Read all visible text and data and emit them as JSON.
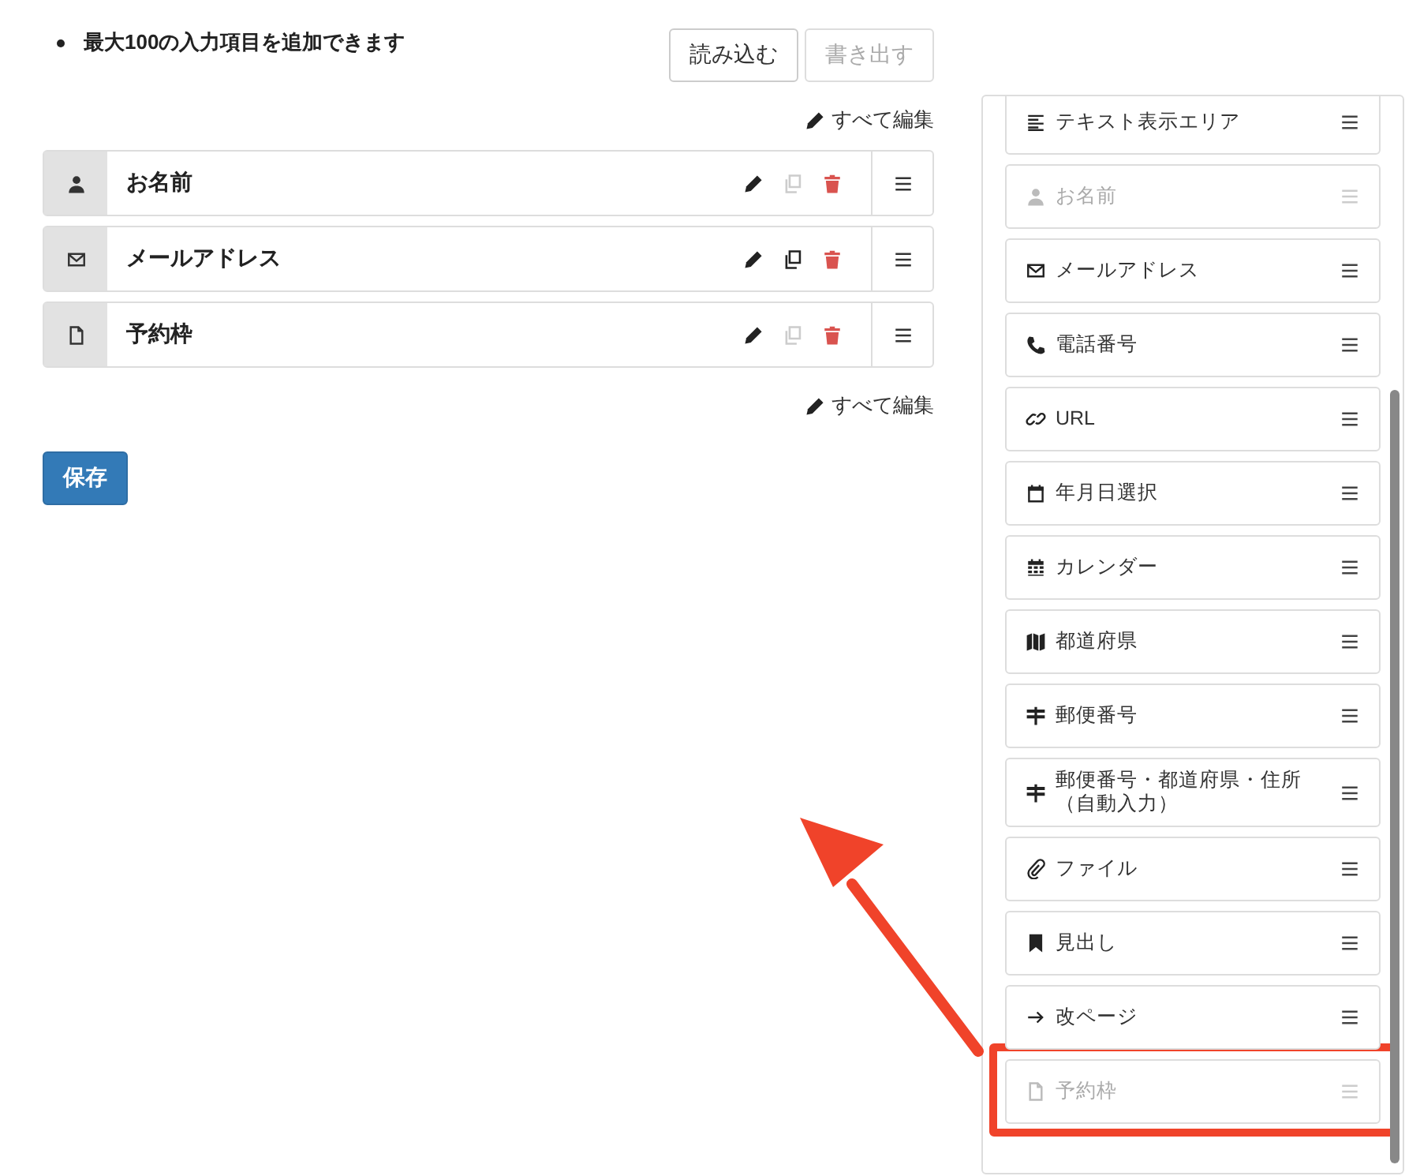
{
  "note": "最大100の入力項目を追加できます",
  "buttons": [
    {
      "label": "読み込む",
      "disabled": false
    },
    {
      "label": "書き出す",
      "disabled": true
    }
  ],
  "edit_all_top": "すべて編集",
  "fields": [
    {
      "kind": "person",
      "label": "お名前",
      "copy_disabled": true
    },
    {
      "kind": "envelope",
      "label": "メールアドレス",
      "copy_disabled": false
    },
    {
      "kind": "file",
      "label": "予約枠",
      "copy_disabled": true
    }
  ],
  "edit_all_bottom": "すべて編集",
  "save_button": "保存",
  "palette": [
    {
      "kind": "text",
      "label": "テキスト表示エリア",
      "disabled": false,
      "highlighted": false
    },
    {
      "kind": "person",
      "label": "お名前",
      "disabled": true,
      "highlighted": false
    },
    {
      "kind": "envelope",
      "label": "メールアドレス",
      "disabled": false,
      "highlighted": false
    },
    {
      "kind": "phone",
      "label": "電話番号",
      "disabled": false,
      "highlighted": false
    },
    {
      "kind": "link",
      "label": "URL",
      "disabled": false,
      "highlighted": false
    },
    {
      "kind": "calendar",
      "label": "年月日選択",
      "disabled": false,
      "highlighted": false
    },
    {
      "kind": "calendar-grid",
      "label": "カレンダー",
      "disabled": false,
      "highlighted": false
    },
    {
      "kind": "map",
      "label": "都道府県",
      "disabled": false,
      "highlighted": false
    },
    {
      "kind": "signpost",
      "label": "郵便番号",
      "disabled": false,
      "highlighted": false
    },
    {
      "kind": "signpost",
      "label": "郵便番号・都道府県・住所（自動入力）",
      "disabled": false,
      "highlighted": false
    },
    {
      "kind": "paperclip",
      "label": "ファイル",
      "disabled": false,
      "highlighted": false
    },
    {
      "kind": "bookmark",
      "label": "見出し",
      "disabled": false,
      "highlighted": false
    },
    {
      "kind": "arrow",
      "label": "改ページ",
      "disabled": false,
      "highlighted": false
    },
    {
      "kind": "file",
      "label": "予約枠",
      "disabled": true,
      "highlighted": true
    }
  ]
}
